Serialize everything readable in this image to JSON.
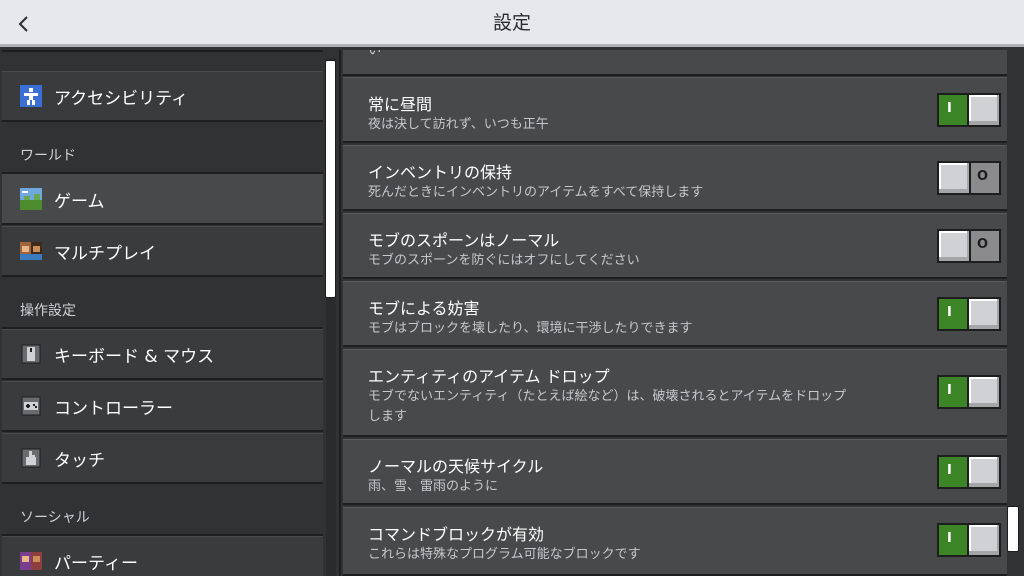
{
  "header": {
    "title": "設定"
  },
  "sidebar": {
    "accessibility": "アクセシビリティ",
    "group_world": "ワールド",
    "game": "ゲーム",
    "multiplayer": "マルチプレイ",
    "group_controls": "操作設定",
    "keyboard_mouse": "キーボード & マウス",
    "controller": "コントローラー",
    "touch": "タッチ",
    "group_social": "ソーシャル",
    "party": "パーティー"
  },
  "settings": {
    "partial_desc": "い",
    "rows": [
      {
        "title": "常に昼間",
        "desc": "夜は決して訪れず、いつも正午",
        "state": "on"
      },
      {
        "title": "インベントリの保持",
        "desc": "死んだときにインベントリのアイテムをすべて保持します",
        "state": "off"
      },
      {
        "title": "モブのスポーンはノーマル",
        "desc": "モブのスポーンを防ぐにはオフにしてください",
        "state": "off"
      },
      {
        "title": "モブによる妨害",
        "desc": "モブはブロックを壊したり、環境に干渉したりできます",
        "state": "on"
      },
      {
        "title": "エンティティのアイテム ドロップ",
        "desc": "モブでないエンティティ（たとえば絵など）は、破壊されるとアイテムをドロップします",
        "state": "on"
      },
      {
        "title": "ノーマルの天候サイクル",
        "desc": "雨、雪、雷雨のように",
        "state": "on"
      },
      {
        "title": "コマンドブロックが有効",
        "desc": "これらは特殊なプログラム可能なブロックです",
        "state": "on"
      }
    ]
  },
  "toggle_marks": {
    "on": "I",
    "off": "O"
  },
  "colors": {
    "toggle_on": "#3c8527",
    "header_bg": "#e6e8eb",
    "panel_bg": "#48494a"
  }
}
